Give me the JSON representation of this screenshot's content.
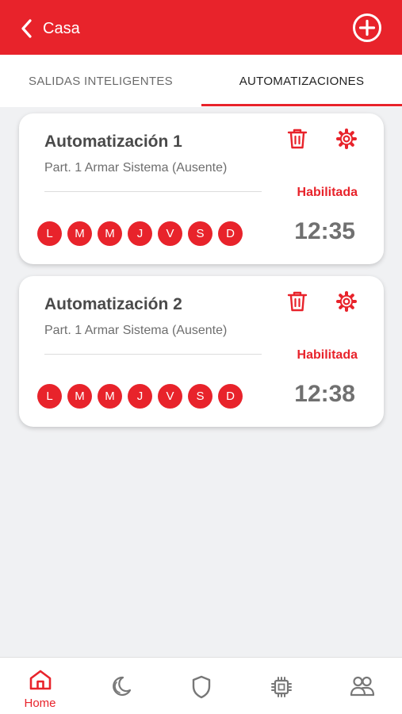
{
  "header": {
    "title": "Casa",
    "back_icon": "chevron-left-icon",
    "add_icon": "plus-circle-icon"
  },
  "tabs": [
    {
      "label": "SALIDAS INTELIGENTES",
      "active": false
    },
    {
      "label": "AUTOMATIZACIONES",
      "active": true
    }
  ],
  "automations": [
    {
      "title": "Automatización 1",
      "subtitle": "Part. 1 Armar Sistema (Ausente)",
      "status": "Habilitada",
      "time": "12:35",
      "days": [
        "L",
        "M",
        "M",
        "J",
        "V",
        "S",
        "D"
      ]
    },
    {
      "title": "Automatización 2",
      "subtitle": "Part. 1 Armar Sistema (Ausente)",
      "status": "Habilitada",
      "time": "12:38",
      "days": [
        "L",
        "M",
        "M",
        "J",
        "V",
        "S",
        "D"
      ]
    }
  ],
  "bottom_nav": [
    {
      "label": "Home",
      "icon": "home-icon",
      "active": true
    },
    {
      "label": "",
      "icon": "moon-icon",
      "active": false
    },
    {
      "label": "",
      "icon": "shield-icon",
      "active": false
    },
    {
      "label": "",
      "icon": "chip-icon",
      "active": false
    },
    {
      "label": "",
      "icon": "users-icon",
      "active": false
    }
  ],
  "colors": {
    "accent": "#e8232b",
    "background": "#f0f1f3",
    "text_dark": "#4a4a4a",
    "text_muted": "#707070",
    "icon_gray": "#777777"
  }
}
